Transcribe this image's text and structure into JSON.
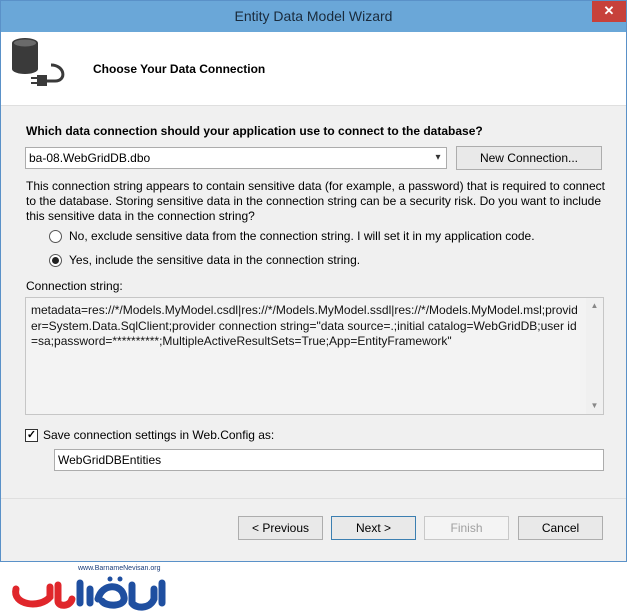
{
  "window": {
    "title": "Entity Data Model Wizard",
    "close_glyph": "✕"
  },
  "header": {
    "title": "Choose Your Data Connection",
    "icon": "database-connection-icon"
  },
  "question": "Which data connection should your application use to connect to the database?",
  "connection_select": {
    "value": "ba-08.WebGridDB.dbo",
    "arrow": "▾"
  },
  "new_connection_button": "New Connection...",
  "sensitive_message": "This connection string appears to contain sensitive data (for example, a password) that is required to connect to the database. Storing sensitive data in the connection string can be a security risk. Do you want to include this sensitive data in the connection string?",
  "options": {
    "exclude": {
      "label": "No, exclude sensitive data from the connection string. I will set it in my application code.",
      "checked": false
    },
    "include": {
      "label": "Yes, include the sensitive data in the connection string.",
      "checked": true
    }
  },
  "connection_string": {
    "label": "Connection string:",
    "value": "metadata=res://*/Models.MyModel.csdl|res://*/Models.MyModel.ssdl|res://*/Models.MyModel.msl;provider=System.Data.SqlClient;provider connection string=\"data source=.;initial catalog=WebGridDB;user id=sa;password=**********;MultipleActiveResultSets=True;App=EntityFramework\""
  },
  "save_settings": {
    "label": "Save connection settings in Web.Config as:",
    "checked": true,
    "check_glyph": "✓",
    "value": "WebGridDBEntities"
  },
  "buttons": {
    "previous": "< Previous",
    "next": "Next >",
    "finish": "Finish",
    "cancel": "Cancel"
  },
  "watermark": {
    "url": "www.BarnameNevisan.org",
    "brand": "برنامه نویسان"
  },
  "colors": {
    "titlebar": "#6aa7d8",
    "close": "#c7413b",
    "logo_red": "#e0262b",
    "logo_blue": "#1f4fa0"
  }
}
